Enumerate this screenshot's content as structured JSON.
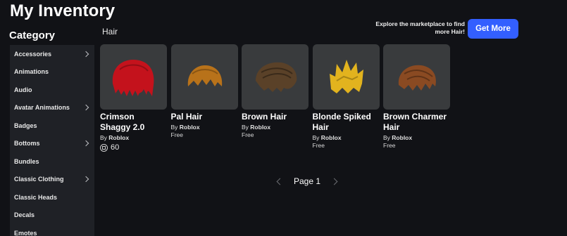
{
  "page": {
    "title": "My Inventory"
  },
  "sidebar": {
    "heading": "Category",
    "items": [
      {
        "label": "Accessories",
        "has_submenu": true
      },
      {
        "label": "Animations",
        "has_submenu": false
      },
      {
        "label": "Audio",
        "has_submenu": false
      },
      {
        "label": "Avatar Animations",
        "has_submenu": true
      },
      {
        "label": "Badges",
        "has_submenu": false
      },
      {
        "label": "Bottoms",
        "has_submenu": true
      },
      {
        "label": "Bundles",
        "has_submenu": false
      },
      {
        "label": "Classic Clothing",
        "has_submenu": true
      },
      {
        "label": "Classic Heads",
        "has_submenu": false
      },
      {
        "label": "Decals",
        "has_submenu": false
      },
      {
        "label": "Emotes",
        "has_submenu": false
      }
    ]
  },
  "main": {
    "section_title": "Hair",
    "promo": {
      "text": "Explore the marketplace to find more Hair!",
      "button_label": "Get More",
      "button_color": "#335fff"
    },
    "items": [
      {
        "name": "Crimson Shaggy 2.0",
        "by_prefix": "By",
        "creator": "Roblox",
        "price": "60",
        "price_type": "robux",
        "hair_color": "#c4121c"
      },
      {
        "name": "Pal Hair",
        "by_prefix": "By",
        "creator": "Roblox",
        "price": "Free",
        "price_type": "free",
        "hair_color": "#b8721a"
      },
      {
        "name": "Brown Hair",
        "by_prefix": "By",
        "creator": "Roblox",
        "price": "Free",
        "price_type": "free",
        "hair_color": "#5a4128"
      },
      {
        "name": "Blonde Spiked Hair",
        "by_prefix": "By",
        "creator": "Roblox",
        "price": "Free",
        "price_type": "free",
        "hair_color": "#e2b31e"
      },
      {
        "name": "Brown Charmer Hair",
        "by_prefix": "By",
        "creator": "Roblox",
        "price": "Free",
        "price_type": "free",
        "hair_color": "#8a4a22"
      }
    ],
    "pagination": {
      "label": "Page 1"
    }
  }
}
